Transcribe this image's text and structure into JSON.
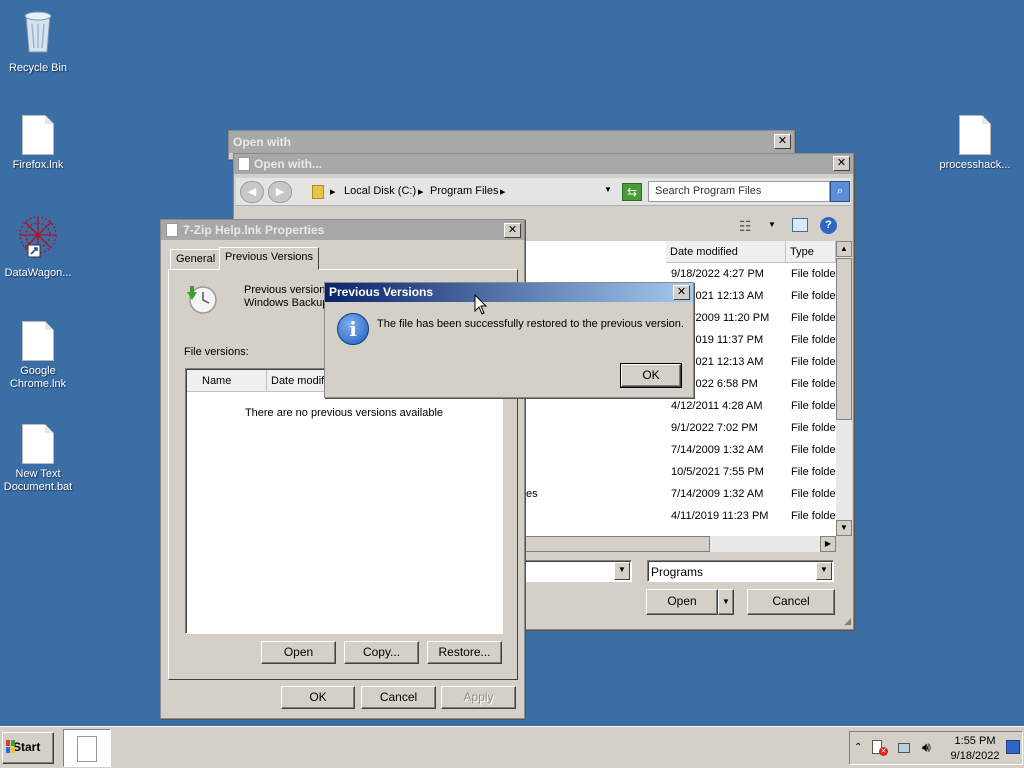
{
  "desktop": {
    "icons": [
      {
        "label": "Recycle Bin"
      },
      {
        "label": "Firefox.lnk"
      },
      {
        "label": "DataWagon..."
      },
      {
        "label": "Google Chrome.lnk"
      },
      {
        "label": "New Text Document.bat"
      },
      {
        "label": "processhack..."
      }
    ]
  },
  "open_with_outer": {
    "title": "Open with"
  },
  "open_with": {
    "title": "Open with...",
    "breadcrumb": [
      "Local Disk (C:)",
      "Program Files"
    ],
    "search_placeholder": "Search Program Files",
    "columns": {
      "date": "Date modified",
      "type": "Type"
    },
    "rows": [
      {
        "date": "9/18/2022 4:27 PM",
        "type": "File folder"
      },
      {
        "date": "3/7/2021 12:13 AM",
        "type": "File folder"
      },
      {
        "date": "7/14/2009 11:20 PM",
        "type": "File folder"
      },
      {
        "date": "3/7/2019 11:37 PM",
        "type": "File folder"
      },
      {
        "date": "3/7/2021 12:13 AM",
        "type": "File folder"
      },
      {
        "date": "9/1/2022 6:58 PM",
        "type": "File folder"
      },
      {
        "date": "4/12/2011 4:28 AM",
        "type": "File folder"
      },
      {
        "date": "9/1/2022 7:02 PM",
        "type": "File folder"
      },
      {
        "date": "7/14/2009 1:32 AM",
        "type": "File folder"
      },
      {
        "date": "10/5/2021 7:55 PM",
        "type": "File folder"
      },
      {
        "date": "7/14/2009 1:32 AM",
        "type": "File folder",
        "name_tail": "es"
      },
      {
        "date": "4/11/2019 11:23 PM",
        "type": "File folder"
      }
    ],
    "filetype": "Programs",
    "open_label": "Open",
    "cancel_label": "Cancel"
  },
  "properties": {
    "title": "7-Zip Help.lnk Properties",
    "tabs": [
      "General",
      "Previous Versions"
    ],
    "info_line1": "Previous version",
    "info_line2": "Windows Backup",
    "file_versions_label": "File versions:",
    "col_name": "Name",
    "col_date": "Date modifi",
    "empty_text": "There are no previous versions available",
    "open_label": "Open",
    "copy_label": "Copy...",
    "restore_label": "Restore...",
    "ok_label": "OK",
    "cancel_label": "Cancel",
    "apply_label": "Apply"
  },
  "message": {
    "title": "Previous Versions",
    "text": "The file has been successfully restored to the previous version.",
    "ok_label": "OK"
  },
  "taskbar": {
    "start_label": "Start",
    "time": "1:55 PM",
    "date": "9/18/2022"
  },
  "colors": {
    "desktop": "#3a6ea5",
    "title_active": "#0a246a",
    "info_blue": "#1c5bbf"
  }
}
